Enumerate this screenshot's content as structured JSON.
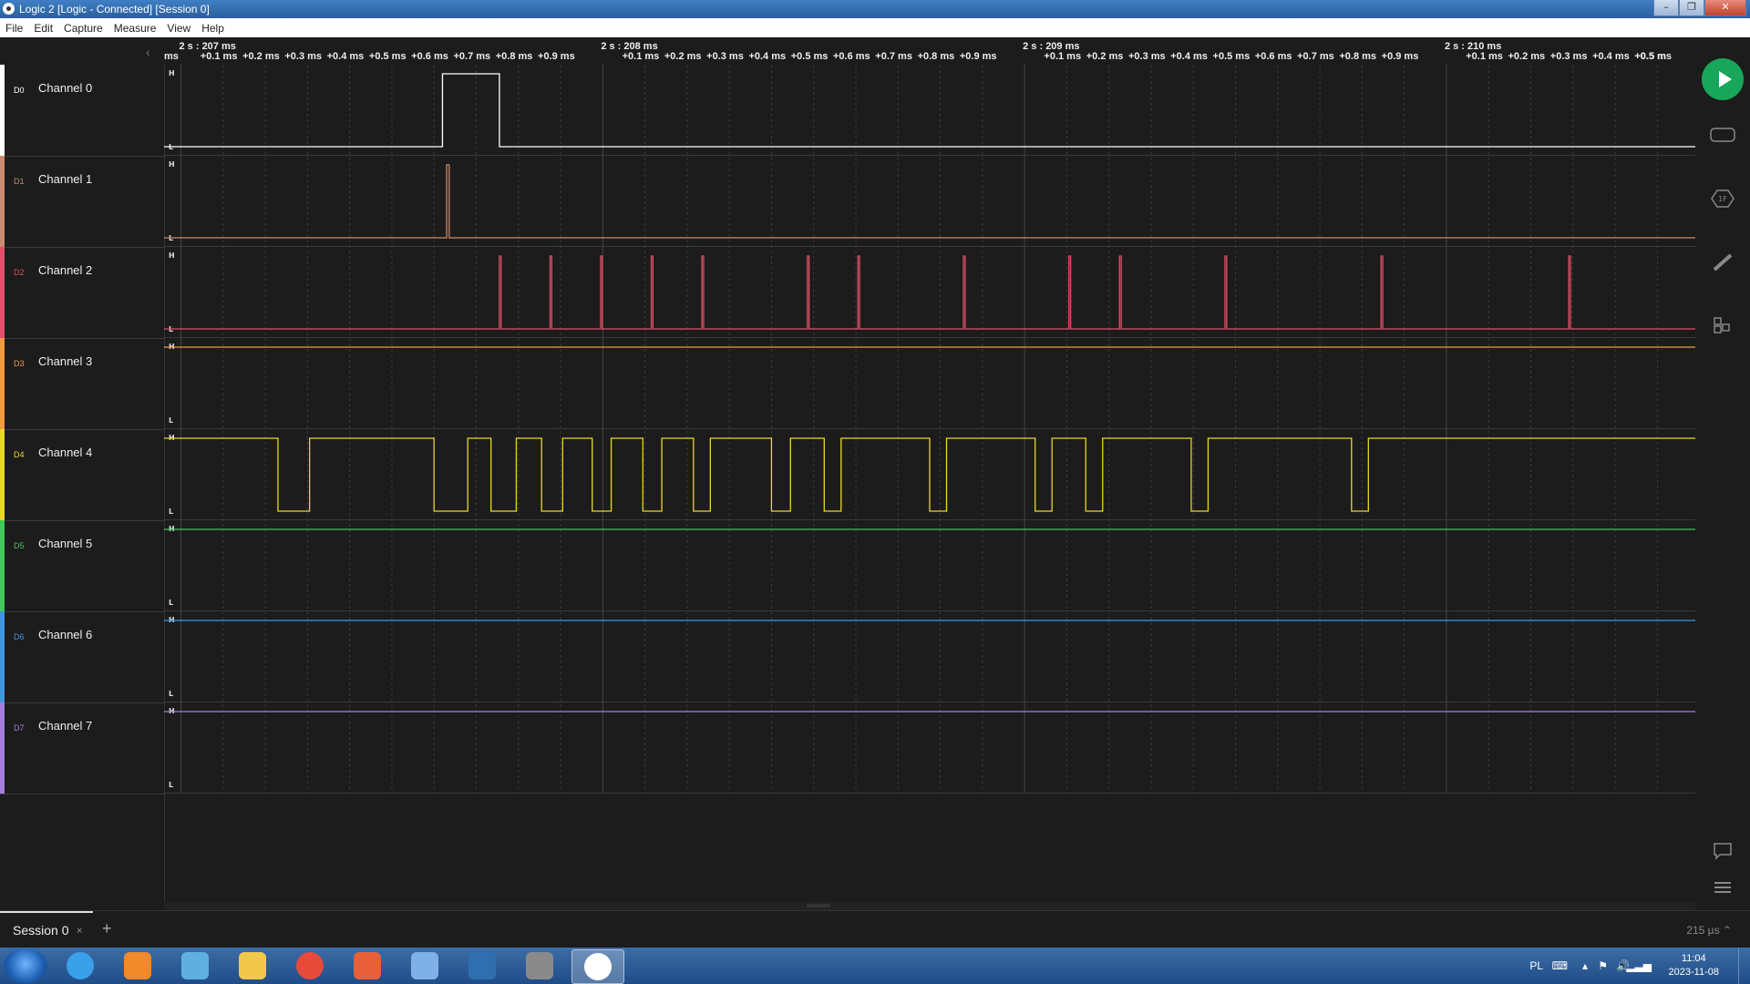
{
  "window": {
    "title": "Logic 2 [Logic - Connected] [Session 0]",
    "buttons": {
      "minimize": "–",
      "maximize": "❐",
      "close": "✕"
    }
  },
  "menu": [
    "File",
    "Edit",
    "Capture",
    "Measure",
    "View",
    "Help"
  ],
  "ruler": {
    "majors": [
      "2 s : 207 ms",
      "2 s : 208 ms",
      "2 s : 209 ms",
      "2 s : 210 ms"
    ],
    "edge_label": "ms",
    "minors": [
      "+0.1 ms",
      "+0.2 ms",
      "+0.3 ms",
      "+0.4 ms",
      "+0.5 ms",
      "+0.6 ms",
      "+0.7 ms",
      "+0.8 ms",
      "+0.9 ms"
    ],
    "last_minor_partial": "+0.5 m"
  },
  "channels": [
    {
      "tag": "D0",
      "name": "Channel 0",
      "color": "#ffffff"
    },
    {
      "tag": "D1",
      "name": "Channel 1",
      "color": "#c98a6e"
    },
    {
      "tag": "D2",
      "name": "Channel 2",
      "color": "#e0506a"
    },
    {
      "tag": "D3",
      "name": "Channel 3",
      "color": "#f09a3c"
    },
    {
      "tag": "D4",
      "name": "Channel 4",
      "color": "#e8d82a"
    },
    {
      "tag": "D5",
      "name": "Channel 5",
      "color": "#3fc95a"
    },
    {
      "tag": "D6",
      "name": "Channel 6",
      "color": "#3d96e0"
    },
    {
      "tag": "D7",
      "name": "Channel 7",
      "color": "#a57ee0"
    }
  ],
  "level_labels": {
    "high": "H",
    "low": "L"
  },
  "signals": {
    "grid_ms_start": 2206.96,
    "grid_ms_end": 2210.59,
    "ch0_high": [
      [
        2207.62,
        2207.755
      ]
    ],
    "ch1_pulses": [
      2207.63
    ],
    "ch2_pulses": [
      2207.755,
      2207.875,
      2207.995,
      2208.115,
      2208.235,
      2208.485,
      2208.605,
      2208.855,
      2209.105,
      2209.225,
      2209.475,
      2209.845,
      2210.29
    ],
    "ch3_level": "high",
    "ch4_low": [
      [
        2207.23,
        2207.305
      ],
      [
        2207.6,
        2207.68
      ],
      [
        2207.735,
        2207.795
      ],
      [
        2207.855,
        2207.905
      ],
      [
        2207.975,
        2208.02
      ],
      [
        2208.095,
        2208.14
      ],
      [
        2208.215,
        2208.255
      ],
      [
        2208.4,
        2208.445
      ],
      [
        2208.525,
        2208.565
      ],
      [
        2208.775,
        2208.815
      ],
      [
        2209.025,
        2209.065
      ],
      [
        2209.145,
        2209.185
      ],
      [
        2209.395,
        2209.435
      ],
      [
        2209.775,
        2209.815
      ]
    ],
    "ch5_level": "high",
    "ch6_level": "high",
    "ch7_level": "high"
  },
  "tabs": {
    "session_label": "Session 0",
    "close": "×",
    "add": "+"
  },
  "timescale": "215 µs ⌃",
  "taskbar": {
    "lang": "PL",
    "time": "11:04",
    "date": "2023-11-08",
    "apps": [
      "internet-explorer",
      "media-player",
      "network",
      "file-explorer",
      "chrome",
      "paint",
      "dots-app",
      "mu-editor",
      "video-editor",
      "logic-analyzer"
    ]
  }
}
